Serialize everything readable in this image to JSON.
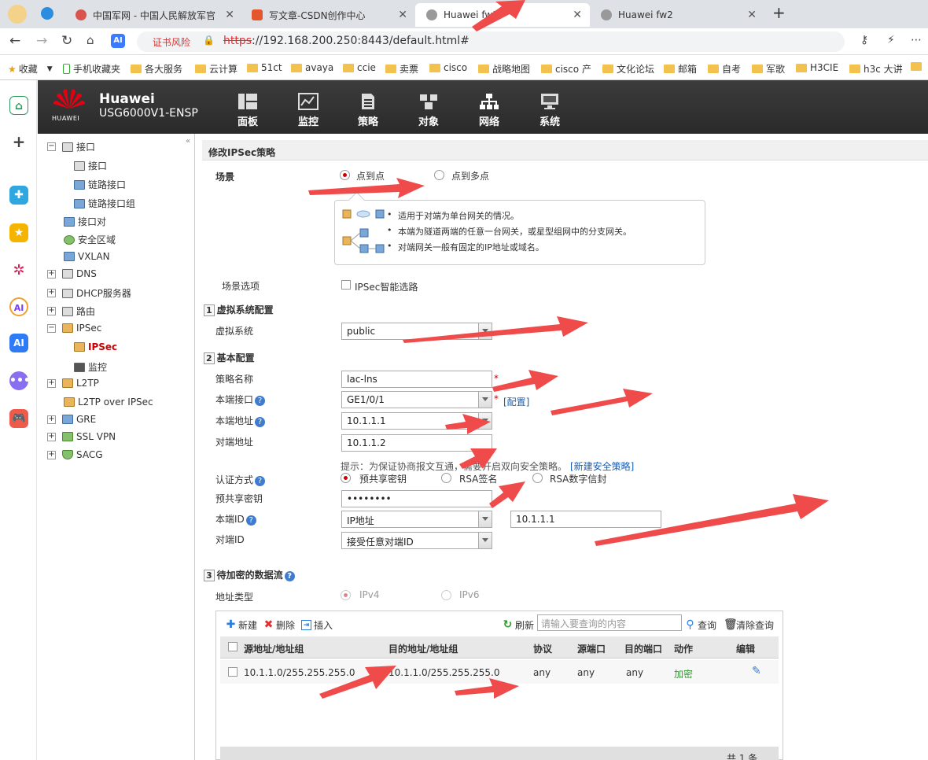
{
  "browser": {
    "tabs": [
      {
        "title": "中国军网 - 中国人民解放军官",
        "favicon": "globe-red"
      },
      {
        "title": "写文章-CSDN创作中心",
        "favicon": "csdn-c"
      },
      {
        "title": "Huawei fw1",
        "favicon": "globe",
        "active": true
      },
      {
        "title": "Huawei fw2",
        "favicon": "globe"
      }
    ],
    "cert_warning": "证书风险",
    "url_scheme": "https",
    "url_rest": "://192.168.200.250:8443/default.html#",
    "ai_badge": "AI",
    "bookmarks": [
      "收藏",
      "手机收藏夹",
      "各大服务",
      "云计算",
      "51ct",
      "avaya",
      "ccie",
      "卖票",
      "cisco",
      "战略地图",
      "cisco 产",
      "文化论坛",
      "邮箱",
      "自考",
      "军歌",
      "H3CIE",
      "h3c 大讲"
    ]
  },
  "header": {
    "logo_text": "HUAWEI",
    "brand": "Huawei",
    "model": "USG6000V1-ENSP",
    "menu": [
      "面板",
      "监控",
      "策略",
      "对象",
      "网络",
      "系统"
    ],
    "active_menu": "网络"
  },
  "tree": {
    "items": [
      {
        "label": "接口",
        "level": 0,
        "expander": "−"
      },
      {
        "label": "接口",
        "level": 1
      },
      {
        "label": "链路接口",
        "level": 1
      },
      {
        "label": "链路接口组",
        "level": 1
      },
      {
        "label": "接口对",
        "level": 0
      },
      {
        "label": "安全区域",
        "level": 0
      },
      {
        "label": "VXLAN",
        "level": 0
      },
      {
        "label": "DNS",
        "level": 0,
        "expander": "+"
      },
      {
        "label": "DHCP服务器",
        "level": 0,
        "expander": "+"
      },
      {
        "label": "路由",
        "level": 0,
        "expander": "+"
      },
      {
        "label": "IPSec",
        "level": 0,
        "expander": "−"
      },
      {
        "label": "IPSec",
        "level": 1,
        "selected": true
      },
      {
        "label": "监控",
        "level": 1
      },
      {
        "label": "L2TP",
        "level": 0,
        "expander": "+"
      },
      {
        "label": "L2TP over IPSec",
        "level": 0
      },
      {
        "label": "GRE",
        "level": 0,
        "expander": "+"
      },
      {
        "label": "SSL VPN",
        "level": 0,
        "expander": "+"
      },
      {
        "label": "SACG",
        "level": 0,
        "expander": "+"
      }
    ]
  },
  "form": {
    "title": "修改IPSec策略",
    "scene_label": "场景",
    "scene_options": [
      "点到点",
      "点到多点"
    ],
    "scene_selected": "点到点",
    "info_lines": [
      "适用于对端为单台网关的情况。",
      "本端为隧道两端的任意一台网关，或星型组网中的分支网关。",
      "对端网关一般有固定的IP地址或域名。"
    ],
    "scene_option_label": "场景选项",
    "smart_route_label": "IPSec智能选路",
    "section1": {
      "num": "1",
      "title": "虚拟系统配置"
    },
    "vsys_label": "虚拟系统",
    "vsys_value": "public",
    "section2": {
      "num": "2",
      "title": "基本配置"
    },
    "policy_name_label": "策略名称",
    "policy_name_value": "lac-lns",
    "local_if_label": "本端接口",
    "local_if_value": "GE1/0/1",
    "config_link": "[配置]",
    "local_addr_label": "本端地址",
    "local_addr_value": "10.1.1.1",
    "peer_addr_label": "对端地址",
    "peer_addr_value": "10.1.1.2",
    "hint_text": "提示：为保证协商报文互通，需要开启双向安全策略。",
    "new_policy_link": "[新建安全策略]",
    "auth_label": "认证方式",
    "auth_options": [
      "预共享密钥",
      "RSA签名",
      "RSA数字信封"
    ],
    "auth_selected": "预共享密钥",
    "psk_label": "预共享密钥",
    "psk_value": "••••••••",
    "local_id_label": "本端ID",
    "local_id_type": "IP地址",
    "local_id_value": "10.1.1.1",
    "peer_id_label": "对端ID",
    "peer_id_value": "接受任意对端ID",
    "section3": {
      "num": "3",
      "title": "待加密的数据流"
    },
    "addr_type_label": "地址类型",
    "addr_type_options": [
      "IPv4",
      "IPv6"
    ],
    "required_mark": "*"
  },
  "flow_table": {
    "toolbar": {
      "new": "新建",
      "delete": "删除",
      "insert": "插入",
      "refresh": "刷新",
      "search_placeholder": "请输入要查询的内容",
      "query": "查询",
      "clear_query": "清除查询"
    },
    "columns": [
      "源地址/地址组",
      "目的地址/地址组",
      "协议",
      "源端口",
      "目的端口",
      "动作",
      "编辑"
    ],
    "rows": [
      {
        "src": "10.1.1.0/255.255.255.0",
        "dst": "10.1.1.0/255.255.255.0",
        "proto": "any",
        "sport": "any",
        "dport": "any",
        "action": "加密"
      }
    ],
    "footer": "共 1 条"
  },
  "colors": {
    "accent_red": "#c00000",
    "link_blue": "#1a5fb4",
    "header_dark": "#333333",
    "action_green": "#2e9a2e",
    "arrow_red": "#ef4b4b"
  }
}
